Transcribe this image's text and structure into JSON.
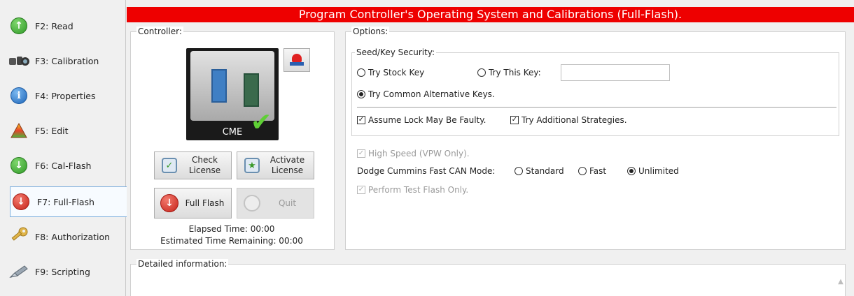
{
  "sidebar": {
    "items": [
      {
        "label": "F2: Read",
        "icon": "up-arrow-green-icon"
      },
      {
        "label": "F3: Calibration",
        "icon": "binoculars-icon"
      },
      {
        "label": "F4: Properties",
        "icon": "info-icon"
      },
      {
        "label": "F5: Edit",
        "icon": "triangle-icon"
      },
      {
        "label": "F6: Cal-Flash",
        "icon": "down-arrow-green-icon"
      },
      {
        "label": "F7: Full-Flash",
        "icon": "down-arrow-red-icon",
        "active": true
      },
      {
        "label": "F8: Authorization",
        "icon": "key-icon"
      },
      {
        "label": "F9: Scripting",
        "icon": "pen-icon"
      }
    ]
  },
  "header": {
    "title": "Program Controller's Operating System and Calibrations (Full-Flash).",
    "color": "#ee0000"
  },
  "controller": {
    "legend": "Controller:",
    "ecu_label": "CME",
    "buttons": {
      "check_license": "Check\nLicense",
      "activate_license": "Activate\nLicense",
      "full_flash": "Full Flash",
      "quit": "Quit"
    },
    "elapsed": "Elapsed Time: 00:00",
    "remaining": "Estimated Time Remaining: 00:00"
  },
  "options": {
    "legend": "Options:",
    "seed_key": {
      "legend": "Seed/Key Security:",
      "try_stock_key": "Try Stock Key",
      "try_this_key": "Try This Key:",
      "this_key_value": "",
      "try_common": "Try Common Alternative Keys.",
      "selected": "try_common",
      "assume_lock": "Assume Lock May Be Faulty.",
      "assume_lock_checked": true,
      "try_additional": "Try Additional Strategies.",
      "try_additional_checked": true
    },
    "high_speed": "High Speed (VPW Only).",
    "high_speed_checked": true,
    "fast_can_label": "Dodge Cummins Fast CAN Mode:",
    "can_modes": [
      "Standard",
      "Fast",
      "Unlimited"
    ],
    "can_selected": "Unlimited",
    "test_flash": "Perform Test Flash Only.",
    "test_flash_checked": true
  },
  "details": {
    "legend": "Detailed information:"
  }
}
